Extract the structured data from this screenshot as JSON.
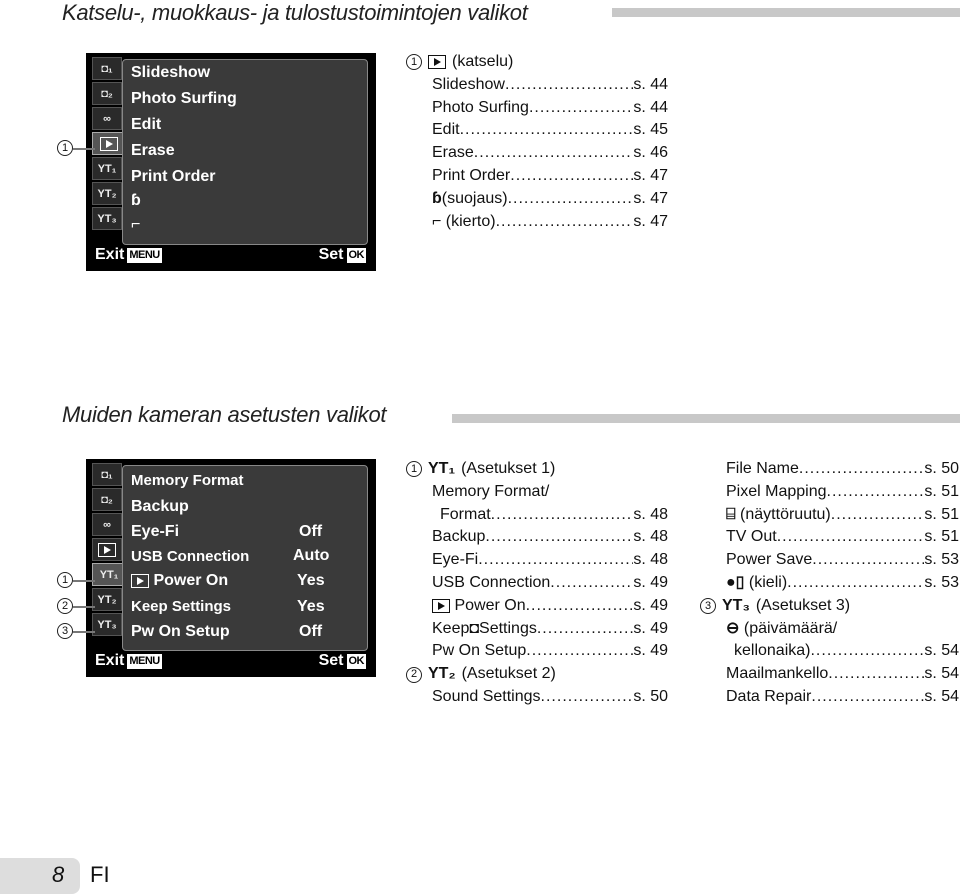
{
  "section1": {
    "title": "Katselu-, muokkaus- ja tulostustoimintojen valikot",
    "screen": {
      "tabs": [
        {
          "icon": "camera-1-icon",
          "label": "◘1"
        },
        {
          "icon": "camera-2-icon",
          "label": "◘2"
        },
        {
          "icon": "movie-icon",
          "label": "🎥"
        },
        {
          "icon": "playback-icon",
          "label": "▶",
          "selected": true
        },
        {
          "icon": "setup-1-icon",
          "label": "ΥT1"
        },
        {
          "icon": "setup-2-icon",
          "label": "ΥT2"
        },
        {
          "icon": "setup-3-icon",
          "label": "ΥT3"
        }
      ],
      "items": [
        "Slideshow",
        "Photo Surfing",
        "Edit",
        "Erase",
        "Print Order",
        "⚷",
        "⤺"
      ],
      "footer": {
        "exit_label": "Exit",
        "exit_key": "MENU",
        "set_label": "Set",
        "set_key": "OK"
      }
    },
    "callout": "1",
    "toc": {
      "heading": "(katselu)",
      "entries": [
        {
          "label": "Slideshow",
          "page": "s. 44"
        },
        {
          "label": "Photo Surfing",
          "page": "s. 44"
        },
        {
          "label": "Edit",
          "page": "s. 45"
        },
        {
          "label": "Erase",
          "page": "s. 46"
        },
        {
          "label": "Print Order",
          "page": "s. 47"
        },
        {
          "label": "(suojaus)",
          "icon": "protect-icon",
          "page": "s. 47"
        },
        {
          "label": "(kierto)",
          "icon": "rotate-icon",
          "page": "s. 47"
        }
      ]
    }
  },
  "section2": {
    "title": "Muiden kameran asetusten valikot",
    "screen": {
      "items": [
        {
          "label": "Memory Format",
          "value": ""
        },
        {
          "label": "Backup",
          "value": ""
        },
        {
          "label": "Eye-Fi",
          "value": "Off"
        },
        {
          "label": "USB Connection",
          "value": "Auto"
        },
        {
          "label": "Power On",
          "value": "Yes"
        },
        {
          "label": "Keep Settings",
          "value": "Yes"
        },
        {
          "label": "Pw On Setup",
          "value": "Off"
        }
      ],
      "footer": {
        "exit_label": "Exit",
        "exit_key": "MENU",
        "set_label": "Set",
        "set_key": "OK"
      }
    },
    "callouts": [
      "1",
      "2",
      "3"
    ],
    "toc_col1": {
      "group1_heading": "(Asetukset 1)",
      "group1_tab": "ΥT1",
      "entries1": [
        {
          "label": "Memory Format/",
          "page": ""
        },
        {
          "label": "Format",
          "page": "s. 48",
          "indent": true
        },
        {
          "label": "Backup",
          "page": "s. 48"
        },
        {
          "label": "Eye-Fi",
          "page": "s. 48"
        },
        {
          "label": "USB Connection",
          "page": "s. 49"
        },
        {
          "label": "Power On",
          "page": "s. 49",
          "icon": "playback-icon"
        },
        {
          "label": "Keep◘Settings",
          "page": "s. 49"
        },
        {
          "label": "Pw On Setup",
          "page": "s. 49"
        }
      ],
      "group2_heading": "(Asetukset 2)",
      "group2_tab": "ΥT2",
      "entries2": [
        {
          "label": "Sound Settings",
          "page": "s. 50"
        }
      ]
    },
    "toc_col2": {
      "entries": [
        {
          "label": "File Name",
          "page": "s. 50"
        },
        {
          "label": "Pixel Mapping",
          "page": "s. 51"
        },
        {
          "label": "(näyttöruutu)",
          "page": "s. 51",
          "icon": "monitor-icon"
        },
        {
          "label": "TV Out",
          "page": "s. 51"
        },
        {
          "label": "Power Save",
          "page": "s. 53"
        },
        {
          "label": "(kieli)",
          "page": "s. 53",
          "icon": "language-icon"
        }
      ],
      "group3_heading": "(Asetukset 3)",
      "group3_tab": "ΥT3",
      "entries3": [
        {
          "label": "(päivämäärä/",
          "page": "",
          "icon": "clock-icon"
        },
        {
          "label": "kellonaika)",
          "page": "s. 54",
          "indent": true
        },
        {
          "label": "Maailmankello",
          "page": "s. 54"
        },
        {
          "label": "Data Repair",
          "page": "s. 54"
        }
      ]
    }
  },
  "page": {
    "number": "8",
    "lang": "FI"
  }
}
